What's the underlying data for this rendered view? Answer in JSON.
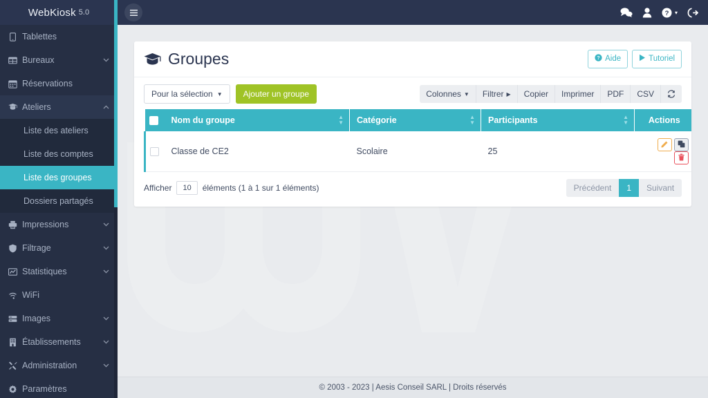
{
  "brand": {
    "name": "WebKiosk",
    "version": "5.0"
  },
  "colors": {
    "sidebar_bg": "#262f44",
    "sidebar_submenu_bg": "#212a3c",
    "accent_teal": "#3ab5c4",
    "topbar_bg": "#2b3550",
    "green": "#9fc326",
    "orange": "#f0ad4e",
    "red": "#e9515c",
    "page_bg": "#e9ebee"
  },
  "sidebar": {
    "items": [
      {
        "label": "Tablettes",
        "icon": "tablet-icon",
        "caret": "",
        "expandable": false,
        "active": false
      },
      {
        "label": "Bureaux",
        "icon": "desktop-grid-icon",
        "caret": "⌄",
        "expandable": true,
        "active": false
      },
      {
        "label": "Réservations",
        "icon": "calendar-icon",
        "caret": "",
        "expandable": false,
        "active": false
      },
      {
        "label": "Ateliers",
        "icon": "graduation-cap-icon",
        "caret": "⌃",
        "expandable": true,
        "active": false,
        "open": true
      },
      {
        "label": "Impressions",
        "icon": "printer-icon",
        "caret": "⌄",
        "expandable": true,
        "active": false
      },
      {
        "label": "Filtrage",
        "icon": "shield-icon",
        "caret": "⌄",
        "expandable": true,
        "active": false
      },
      {
        "label": "Statistiques",
        "icon": "chart-line-icon",
        "caret": "⌄",
        "expandable": true,
        "active": false
      },
      {
        "label": "WiFi",
        "icon": "wifi-icon",
        "caret": "",
        "expandable": false,
        "active": false
      },
      {
        "label": "Images",
        "icon": "server-icon",
        "caret": "⌄",
        "expandable": true,
        "active": false
      },
      {
        "label": "Établissements",
        "icon": "building-icon",
        "caret": "⌄",
        "expandable": true,
        "active": false
      },
      {
        "label": "Administration",
        "icon": "tools-icon",
        "caret": "⌄",
        "expandable": true,
        "active": false
      },
      {
        "label": "Paramètres",
        "icon": "gear-icon",
        "caret": "",
        "expandable": false,
        "active": false
      }
    ],
    "ateliers_submenu": [
      {
        "label": "Liste des ateliers",
        "active": false
      },
      {
        "label": "Liste des comptes",
        "active": false
      },
      {
        "label": "Liste des groupes",
        "active": true
      },
      {
        "label": "Dossiers partagés",
        "active": false
      }
    ]
  },
  "topbar": {
    "menu_toggle_icon": "hamburger-icon",
    "icons": [
      {
        "name": "chat-bubbles-icon",
        "label": "Messages"
      },
      {
        "name": "user-icon",
        "label": "Utilisateur"
      },
      {
        "name": "help-circle-icon",
        "label": "Aide"
      },
      {
        "name": "logout-icon",
        "label": "Déconnexion"
      }
    ]
  },
  "page": {
    "title": "Groupes",
    "title_icon": "graduation-cap-icon",
    "help_button": "Aide",
    "tutorial_button": "Tutoriel"
  },
  "toolbar": {
    "selection_dropdown": "Pour la sélection",
    "add_group_button": "Ajouter un groupe",
    "export_buttons": [
      {
        "label": "Colonnes",
        "icon": "caret-down-icon"
      },
      {
        "label": "Filtrer",
        "icon": "caret-right-icon"
      },
      {
        "label": "Copier",
        "icon": ""
      },
      {
        "label": "Imprimer",
        "icon": ""
      },
      {
        "label": "PDF",
        "icon": ""
      },
      {
        "label": "CSV",
        "icon": ""
      }
    ],
    "refresh_icon": "refresh-icon"
  },
  "table": {
    "columns": [
      {
        "label": "Nom du groupe",
        "sortable": true
      },
      {
        "label": "Catégorie",
        "sortable": true
      },
      {
        "label": "Participants",
        "sortable": true
      },
      {
        "label": "Actions",
        "sortable": false
      }
    ],
    "rows": [
      {
        "name": "Classe de CE2",
        "category": "Scolaire",
        "participants": "25",
        "actions": [
          {
            "name": "edit-button",
            "icon": "pencil-icon"
          },
          {
            "name": "duplicate-button",
            "icon": "copy-icon"
          },
          {
            "name": "delete-button",
            "icon": "trash-icon"
          }
        ]
      }
    ]
  },
  "table_footer": {
    "show_label": "Afficher",
    "entries_value": "10",
    "entries_suffix": "éléments (1 à 1 sur 1 éléments)",
    "pagination": {
      "previous": "Précédent",
      "current_page": "1",
      "next": "Suivant"
    }
  },
  "footer": {
    "copyright": "© 2003 - 2023 | Aesis Conseil SARL | Droits réservés"
  }
}
